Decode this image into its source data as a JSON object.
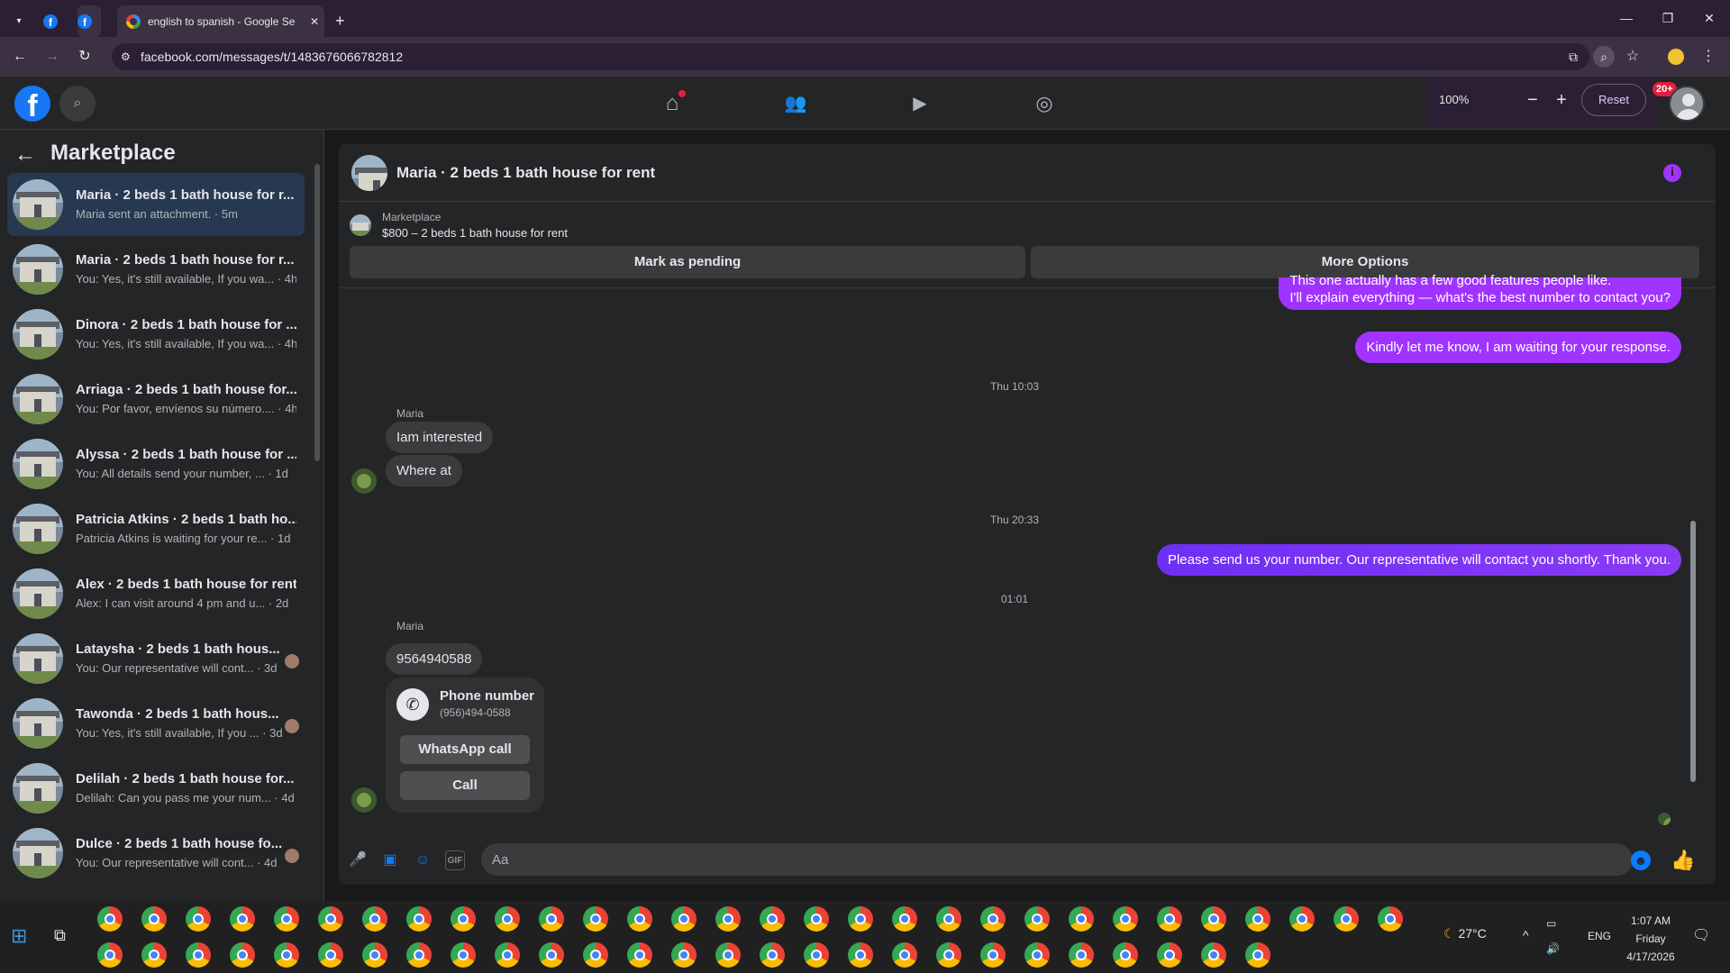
{
  "browser": {
    "active_tab_title": "english to spanish - Google Se",
    "url": "facebook.com/messages/t/1483676066782812",
    "zoom": {
      "value": "100%",
      "reset_label": "Reset"
    }
  },
  "header": {
    "notification_badge": "20+"
  },
  "sidebar": {
    "title": "Marketplace",
    "conversations": [
      {
        "name": "Maria · 2 beds 1 bath house for r...",
        "preview": "Maria sent an attachment. · 5m"
      },
      {
        "name": "Maria · 2 beds 1 bath house for r...",
        "preview": "You: Yes, it's still available, If you wa... · 4h"
      },
      {
        "name": "Dinora · 2 beds 1 bath house for ...",
        "preview": "You: Yes, it's still available, If you wa... · 4h"
      },
      {
        "name": "Arriaga · 2 beds 1 bath house for...",
        "preview": "You: Por favor, envíenos su número.... · 4h"
      },
      {
        "name": "Alyssa · 2 beds 1 bath house for ...",
        "preview": "You: All details send your number, ... · 1d"
      },
      {
        "name": "Patricia Atkins · 2 beds 1 bath ho...",
        "preview": "Patricia Atkins is waiting for your re... · 1d"
      },
      {
        "name": "Alex · 2 beds 1 bath house for rent",
        "preview": "Alex: I can visit around 4 pm and u... · 2d"
      },
      {
        "name": "Lataysha · 2 beds 1 bath hous...",
        "preview": "You: Our representative will cont... · 3d"
      },
      {
        "name": "Tawonda · 2 beds 1 bath hous...",
        "preview": "You: Yes, it's still available, If you ... · 3d"
      },
      {
        "name": "Delilah · 2 beds 1 bath house for...",
        "preview": "Delilah: Can you pass me your num... · 4d"
      },
      {
        "name": "Dulce · 2 beds 1 bath house fo...",
        "preview": "You: Our representative will cont... · 4d"
      }
    ]
  },
  "chat": {
    "title": "Maria · 2 beds 1 bath house for rent",
    "listing_label": "Marketplace",
    "listing_price": "$800 – 2 beds 1 bath house for rent",
    "mark_pending_label": "Mark as pending",
    "more_options_label": "More Options",
    "messages": {
      "out1_line1": "This one actually has a few good features people like.",
      "out1_line2": "I'll explain everything — what's the best number to contact you?",
      "out2": "Kindly let me know, I am waiting for your response.",
      "stamp1": "Thu 10:03",
      "sender1": "Maria",
      "in1": "Iam interested",
      "in2": "Where at",
      "stamp2": "Thu 20:33",
      "out3": "Please send us your number. Our representative will contact you shortly. Thank you.",
      "stamp3": "01:01",
      "sender2": "Maria",
      "in3": "9564940588"
    },
    "phone_card": {
      "title": "Phone number",
      "number": "(956)494-0588",
      "whatsapp_label": "WhatsApp call",
      "call_label": "Call"
    },
    "composer_placeholder": "Aa"
  },
  "taskbar": {
    "weather": "27°C",
    "language": "ENG",
    "time": "1:07 AM",
    "day": "Friday",
    "date": "4/17/2026"
  }
}
